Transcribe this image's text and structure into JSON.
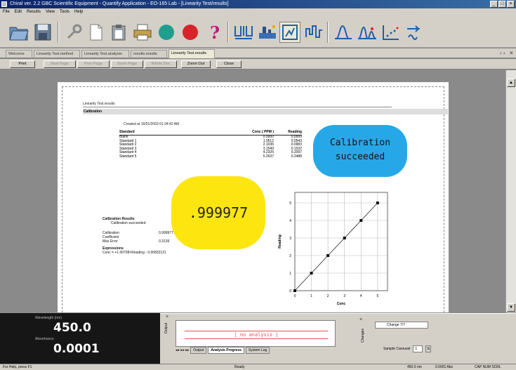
{
  "window": {
    "title": "Chiral ver. 2.2 GBC Scientific Equipment - Quantify Application - EO-165 Lab - [Linearity Test/results]",
    "controls": [
      "_",
      "□",
      "×"
    ]
  },
  "menu": [
    "File",
    "Edit",
    "Results",
    "View",
    "Tools",
    "Help"
  ],
  "toolbar": {
    "icons": [
      "open-folder-icon",
      "save-icon",
      "wrench-icon",
      "document-icon",
      "clipboard-icon",
      "print-icon",
      "green-circle-icon",
      "red-stop-icon",
      "help-icon",
      "sample-grid-icon",
      "instrument-icon",
      "calibration-view-icon",
      "wave-icon",
      "peak-icon",
      "multi-peak-icon",
      "scatter-icon",
      "transfer-icon"
    ]
  },
  "tabs": [
    "Welcome",
    "Linearity Test.method",
    "Linearity Test.analysis",
    "results.results",
    "Linearity Test.results"
  ],
  "viewbar": {
    "buttons": [
      "Print",
      "Next Page",
      "Prev Page",
      "Zoom Page",
      "Whole Doc",
      "Zoom Out",
      "Close"
    ]
  },
  "report": {
    "header": "Linearity Test.results",
    "section": "Calibration",
    "created": "Created at 16/01/2003 01:34:42 AM",
    "table": {
      "headers": [
        "Standard",
        "Conc ( PPM )",
        "Reading"
      ],
      "rows": [
        [
          "Blank",
          "0.0000",
          "0.0000"
        ],
        [
          "Standard 1",
          "1.0512",
          "0.0543"
        ],
        [
          "Standard 2",
          "2.1036",
          "0.0983"
        ],
        [
          "Standard 3",
          "3.1549",
          "0.1532"
        ],
        [
          "Standard 4",
          "4.2325",
          "0.2097"
        ],
        [
          "Standard 5",
          "5.2637",
          "0.2488"
        ]
      ]
    },
    "results": {
      "title": "Calibration Results",
      "status": "Calibration succeeded",
      "calibration_label": "Calibration",
      "calibration_value": "0.999977",
      "coefficient_label": "Coefficient",
      "max_error_label": "Max Error",
      "max_error_value": "0.3139",
      "expression_title": "Expressions",
      "expression": "Conc = +1.00708×Reading - 0.00832121"
    }
  },
  "chart_data": {
    "type": "line",
    "xlabel": "Conc",
    "ylabel": "Reading",
    "x": [
      0,
      1,
      2,
      3,
      4,
      5
    ],
    "xticks": [
      "0",
      "1",
      "2",
      "3",
      "4",
      "5"
    ],
    "yticks": [
      "0",
      "1",
      "2",
      "3",
      "4",
      "5"
    ],
    "xlim": [
      0,
      5.6
    ],
    "ylim": [
      0,
      5.6
    ],
    "series": [
      {
        "values": [
          0,
          1,
          2,
          3,
          4,
          5
        ]
      }
    ],
    "grid": true
  },
  "callouts": {
    "correlation": ".999977",
    "status_line1": "Calibration",
    "status_line2": "succeeded"
  },
  "readout": {
    "wavelength_label": "Wavelength (nm)",
    "wavelength_value": "450.0",
    "absorbance_label": "Absorbance",
    "absorbance_value": "0.0001"
  },
  "output": {
    "caption": "Output",
    "message": "[ no analysis ]",
    "tabs": [
      "Output",
      "Analysis Progress",
      "System Log"
    ]
  },
  "changes": {
    "caption": "Changes",
    "label": "Change 7/7",
    "sample_label": "Sample Carousel",
    "sample_value": "1"
  },
  "status": {
    "help": "For Help, press F1",
    "ready": "Ready",
    "wavelength": "450.0 nm",
    "absorbance": "0.0001 Abs",
    "flags": "CAP NUM SCRL"
  }
}
